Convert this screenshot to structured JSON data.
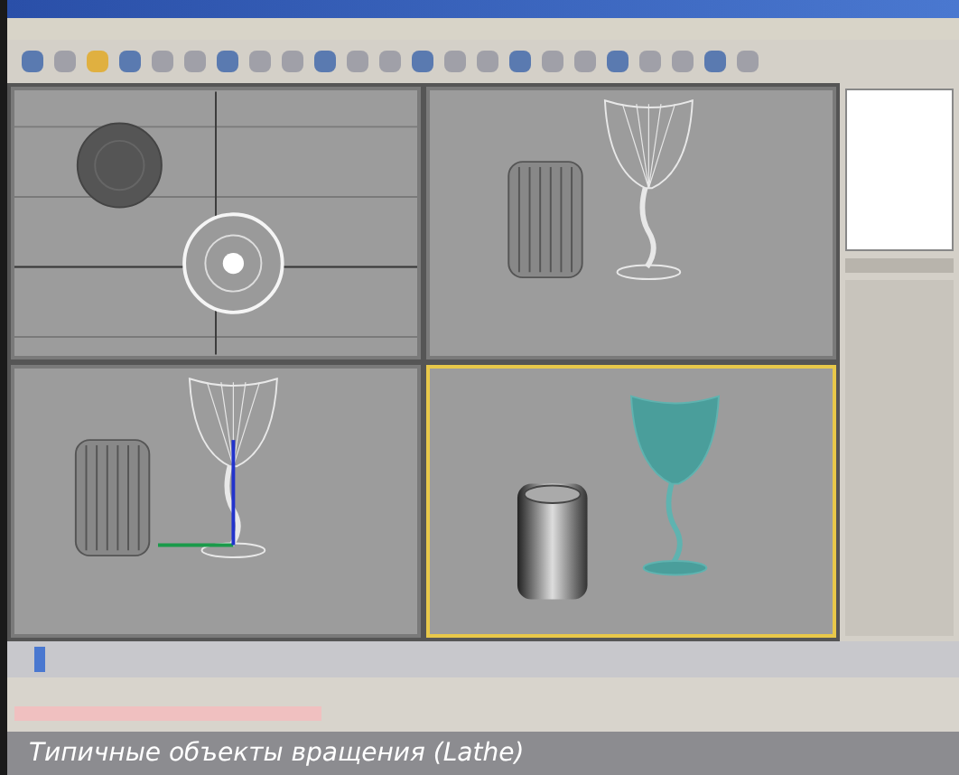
{
  "viewports": [
    {
      "kind": "top",
      "selected": false
    },
    {
      "kind": "front",
      "selected": false
    },
    {
      "kind": "left",
      "selected": false
    },
    {
      "kind": "perspective",
      "selected": true
    }
  ],
  "timeline": {
    "level": 0.02
  },
  "caption": "Типичные объекты вращения (Lathe)"
}
